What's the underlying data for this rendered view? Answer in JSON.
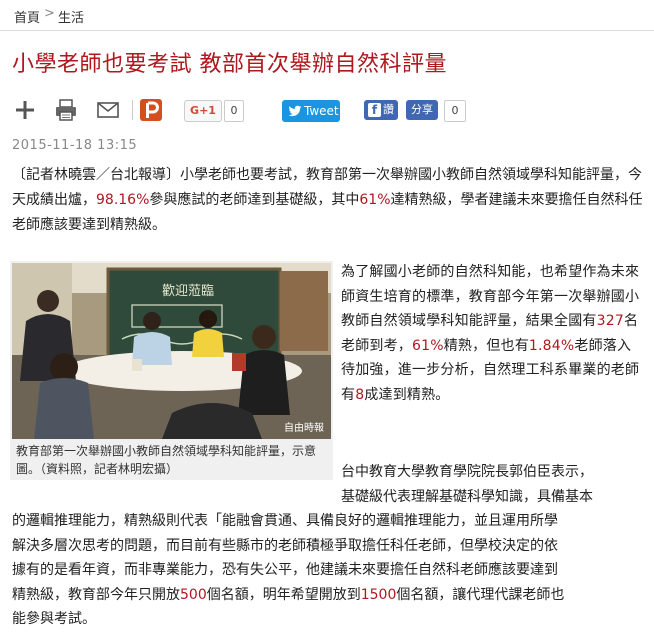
{
  "breadcrumb": {
    "home": "首頁",
    "separator": ">",
    "section": "生活"
  },
  "article": {
    "title": "小學老師也要考試 教部首次舉辦自然科評量",
    "date": "2015-11-18   13:15",
    "lead": {
      "p1": "〔記者林曉雲／台北報導〕小學老師也要考試，教育部第一次舉辦國小教師自然領域學科知能評量，今天成績出爐，",
      "pct1": "98.16%",
      "p2": "參與應試的老師達到基礎級，其中",
      "pct2": "61%",
      "p3": "達精熟級，學者建議未來要擔任自然科任老師應該要達到精熟級。"
    },
    "figure": {
      "caption": "教育部第一次舉辦國小教師自然領域學科知能評量，示意圖。（資料照，記者林明宏攝）",
      "watermark": "自由時報",
      "chalkboard_text": "歡迎蒞臨"
    },
    "side": {
      "s1": "為了解國小老師的自然科知能，也希望作為未來師資生培育的標準，教育部今年第一次舉辦國小教師自然領域學科知能評量，結果全國有",
      "n1": "327",
      "s2": "名老師到考，",
      "n2": "61%",
      "s3": "精熟，但也有",
      "n3": "1.84%",
      "s4": "老師落入待加強，進一步分析，自然理工科系畢業的老師有",
      "n4": "8",
      "s5": "成達到精熟。"
    },
    "para2": {
      "l1": "台中教育大學教育學院院長郭伯臣表示，",
      "l2": "基礎級代表理解基礎科學知識，具備基本",
      "l3": "的邏輯推理能力，精熟級則代表「能融會貫通、具備良好的邏輯推理能力，並且運用所學",
      "l4": "解決多層次思考的問題，而目前有些縣市的老師積極爭取擔任科任老師，但學校決定的依",
      "l5": "據有的是看年資，而非專業能力，恐有失公平，他建議未來要擔任自然科老師應該要達到",
      "l6a": "精熟級，教育部今年只開放",
      "n500": "500",
      "l6b": "個名額，明年希望開放到",
      "n1500": "1500",
      "l6c": "個名額，讓代理代課老師也",
      "l7": "能參與考試。"
    }
  },
  "toolbar": {
    "gplus_label": "G+1",
    "gplus_count": "0",
    "tweet_label": "Tweet",
    "fb_label": "讚",
    "share_label": "分享",
    "share_count": "0"
  },
  "colors": {
    "title": "#b0171f",
    "highlight": "#b0171f",
    "twitter": "#1b95e0",
    "facebook": "#4267b2",
    "plurk": "#d34f1d"
  }
}
